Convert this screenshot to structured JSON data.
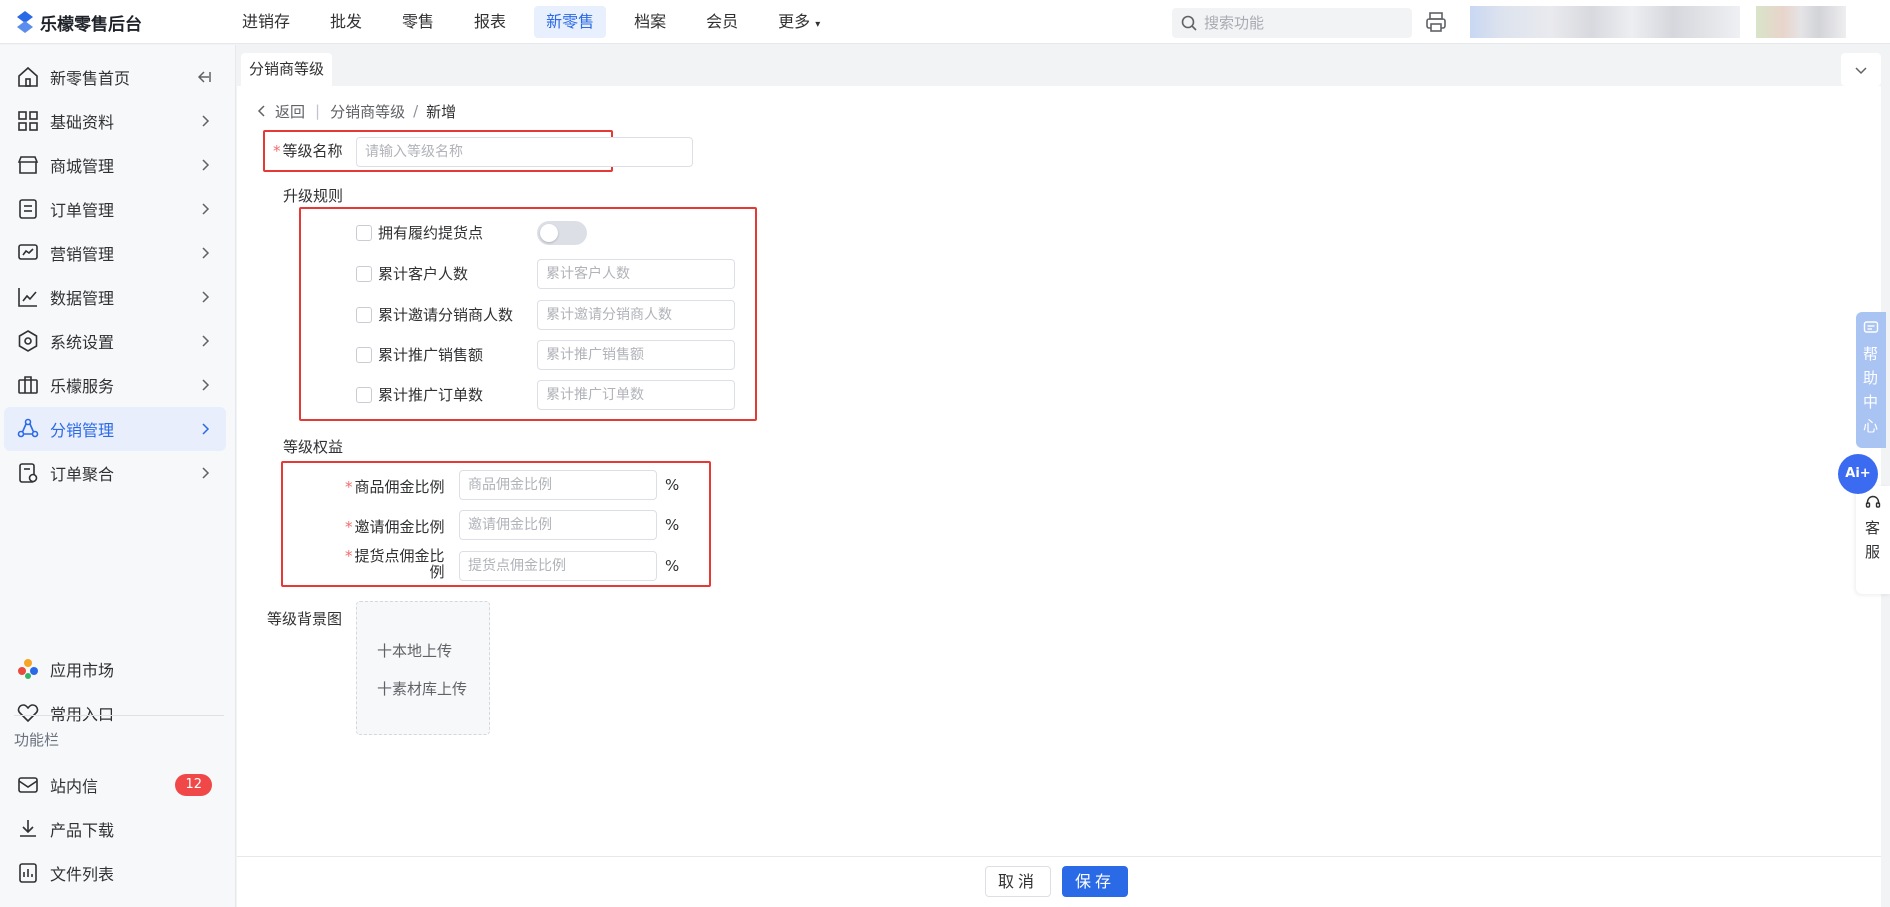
{
  "app": {
    "title": "乐檬零售后台",
    "brand_color": "#2b6ae6"
  },
  "topnav": [
    "进销存",
    "批发",
    "零售",
    "报表",
    "新零售",
    "档案",
    "会员",
    "更多"
  ],
  "topnav_active_index": 4,
  "search": {
    "placeholder": "搜索功能"
  },
  "sidebar": {
    "items": [
      {
        "label": "新零售首页",
        "icon": "home-icon"
      },
      {
        "label": "基础资料",
        "icon": "grid-icon"
      },
      {
        "label": "商城管理",
        "icon": "store-icon"
      },
      {
        "label": "订单管理",
        "icon": "order-icon"
      },
      {
        "label": "营销管理",
        "icon": "marketing-icon"
      },
      {
        "label": "数据管理",
        "icon": "chart-icon"
      },
      {
        "label": "系统设置",
        "icon": "settings-icon"
      },
      {
        "label": "乐檬服务",
        "icon": "briefcase-icon"
      },
      {
        "label": "分销管理",
        "icon": "distribution-icon"
      },
      {
        "label": "订单聚合",
        "icon": "order-aggregate-icon"
      }
    ],
    "active_index": 8,
    "bottom": [
      {
        "label": "应用市场",
        "icon": "app-market-icon"
      },
      {
        "label": "常用入口",
        "icon": "heart-icon"
      }
    ],
    "section_title": "功能栏",
    "tools": [
      {
        "label": "站内信",
        "icon": "mail-icon",
        "badge": "12"
      },
      {
        "label": "产品下载",
        "icon": "download-icon"
      },
      {
        "label": "文件列表",
        "icon": "file-list-icon"
      }
    ]
  },
  "tab": {
    "label": "分销商等级"
  },
  "breadcrumb": {
    "back": "返回",
    "parent": "分销商等级",
    "sep": "/",
    "current": "新增"
  },
  "form": {
    "level_name": {
      "label": "等级名称",
      "placeholder": "请输入等级名称"
    },
    "upgrade_title": "升级规则",
    "rules": [
      {
        "label": "拥有履约提货点",
        "type": "switch",
        "on": false
      },
      {
        "label": "累计客户人数",
        "placeholder": "累计客户人数"
      },
      {
        "label": "累计邀请分销商人数",
        "placeholder": "累计邀请分销商人数"
      },
      {
        "label": "累计推广销售额",
        "placeholder": "累计推广销售额"
      },
      {
        "label": "累计推广订单数",
        "placeholder": "累计推广订单数"
      }
    ],
    "benefits_title": "等级权益",
    "benefits": [
      {
        "label": "商品佣金比例",
        "placeholder": "商品佣金比例",
        "unit": "%"
      },
      {
        "label": "邀请佣金比例",
        "placeholder": "邀请佣金比例",
        "unit": "%"
      },
      {
        "label_line1": "提货点佣金比",
        "label_line2": "例",
        "placeholder": "提货点佣金比例",
        "unit": "%"
      }
    ],
    "bg_title": "等级背景图",
    "upload_local": "本地上传",
    "upload_library": "素材库上传"
  },
  "footer": {
    "cancel": "取消",
    "save": "保存"
  },
  "float": {
    "help": [
      "帮",
      "助",
      "中",
      "心"
    ],
    "ai": "Ai+",
    "service": [
      "客",
      "服"
    ]
  }
}
